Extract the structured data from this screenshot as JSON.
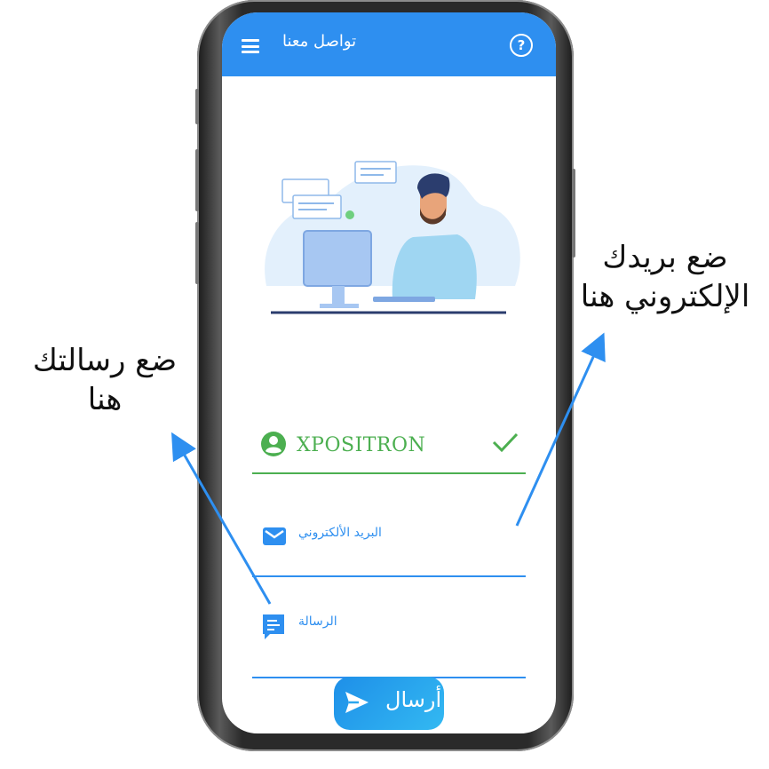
{
  "appbar": {
    "title": "تواصل معنا",
    "menu_icon": "hamburger-menu-icon",
    "help_icon": "help-circle-icon",
    "background": "#2e8ff0"
  },
  "form": {
    "name": {
      "value": "XPOSITRON",
      "icon": "user-circle-icon",
      "status_icon": "checkmark-icon",
      "color": "#4caf50"
    },
    "email": {
      "placeholder": "البريد الألكتروني",
      "icon": "mail-icon",
      "color": "#2e8ff0"
    },
    "message": {
      "placeholder": "الرسالة",
      "icon": "message-icon",
      "color": "#2e8ff0"
    }
  },
  "send_button": {
    "label": "أرسال",
    "icon": "send-icon"
  },
  "annotations": {
    "left": {
      "line1": "ضع رسالتك",
      "line2": "هنا"
    },
    "right": {
      "line1": "ضع بريدك",
      "line2": "الإلكتروني هنا"
    }
  }
}
